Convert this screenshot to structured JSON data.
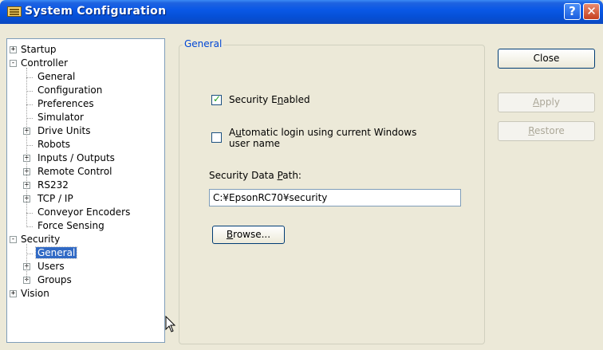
{
  "window": {
    "title": "System Configuration",
    "help_glyph": "?",
    "close_glyph": "✕"
  },
  "tree": {
    "items": [
      {
        "label": "Startup",
        "expander": "+"
      },
      {
        "label": "Controller",
        "expander": "−"
      },
      {
        "label": "General"
      },
      {
        "label": "Configuration"
      },
      {
        "label": "Preferences"
      },
      {
        "label": "Simulator"
      },
      {
        "label": "Drive Units",
        "expander": "+"
      },
      {
        "label": "Robots"
      },
      {
        "label": "Inputs / Outputs",
        "expander": "+"
      },
      {
        "label": "Remote Control",
        "expander": "+"
      },
      {
        "label": "RS232",
        "expander": "+"
      },
      {
        "label": "TCP / IP",
        "expander": "+"
      },
      {
        "label": "Conveyor Encoders"
      },
      {
        "label": "Force Sensing"
      },
      {
        "label": "Security",
        "expander": "−"
      },
      {
        "label": "General",
        "selected": true
      },
      {
        "label": "Users",
        "expander": "+"
      },
      {
        "label": "Groups",
        "expander": "+"
      },
      {
        "label": "Vision",
        "expander": "+"
      }
    ]
  },
  "general": {
    "group_title": "General",
    "security_enabled": {
      "pre": "Security E",
      "mnemonic": "n",
      "post": "abled",
      "checked": true
    },
    "auto_login": {
      "pre": "A",
      "mnemonic": "u",
      "post": "tomatic login using current Windows",
      "line2": "user name",
      "checked": false
    },
    "path_label": {
      "pre": "Security Data ",
      "mnemonic": "P",
      "post": "ath:"
    },
    "path_value": "C:¥EpsonRC70¥security",
    "browse": {
      "mnemonic": "B",
      "post": "rowse..."
    }
  },
  "buttons": {
    "close": "Close",
    "apply": {
      "mnemonic": "A",
      "post": "pply"
    },
    "restore": {
      "mnemonic": "R",
      "post": "estore"
    }
  },
  "colors": {
    "title_bar": "#0a58e6",
    "selection": "#316ac5",
    "group_title": "#0046d5"
  }
}
